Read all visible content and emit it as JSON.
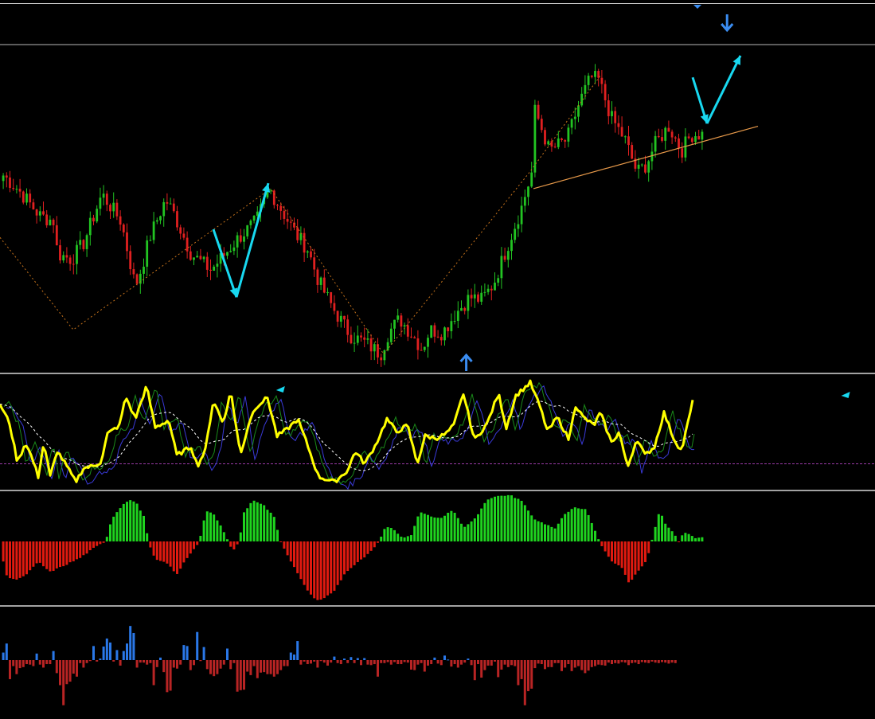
{
  "colors": {
    "background": "#000000",
    "separator": "#d8d8d8",
    "level_line": "#b8b8b8",
    "bull_candle": "#22c422",
    "bear_candle": "#e02020",
    "zigzag": "#c8741c",
    "trendline": "#e89a4a",
    "arrow": "#18d8f0",
    "signal_arrow": "#3a8cf0",
    "oscillator_main": "#ffff00",
    "oscillator_fast": "#1a8a1a",
    "oscillator_slow": "#3a3ad8",
    "oscillator_signal": "#ffffff",
    "oscillator_level": "#9a3aa8",
    "histogram_pos": "#1fd41f",
    "histogram_neg": "#e01a10",
    "volume_pos": "#2a78e8",
    "volume_neg": "#b82424"
  },
  "chart_data": [
    {
      "type": "candlestick",
      "pane": "price",
      "title": "",
      "xlabel": "",
      "ylabel": "",
      "ylim": [
        0,
        100
      ],
      "grid": false,
      "bars": 210,
      "path_points": [
        [
          0,
          70
        ],
        [
          22,
          64
        ],
        [
          50,
          54
        ],
        [
          68,
          52
        ],
        [
          72,
          40
        ],
        [
          90,
          38
        ],
        [
          105,
          44
        ],
        [
          128,
          62
        ],
        [
          140,
          57
        ],
        [
          152,
          52
        ],
        [
          170,
          28
        ],
        [
          178,
          35
        ],
        [
          188,
          46
        ],
        [
          208,
          60
        ],
        [
          218,
          55
        ],
        [
          240,
          40
        ],
        [
          265,
          34
        ],
        [
          300,
          46
        ],
        [
          322,
          52
        ],
        [
          338,
          64
        ],
        [
          352,
          57
        ],
        [
          372,
          47
        ],
        [
          386,
          42
        ],
        [
          400,
          30
        ],
        [
          418,
          20
        ],
        [
          440,
          10
        ],
        [
          460,
          7
        ],
        [
          478,
          3
        ],
        [
          488,
          11
        ],
        [
          502,
          16
        ],
        [
          518,
          10
        ],
        [
          530,
          5
        ],
        [
          540,
          12
        ],
        [
          556,
          11
        ],
        [
          572,
          18
        ],
        [
          590,
          24
        ],
        [
          605,
          23
        ],
        [
          620,
          29
        ],
        [
          640,
          45
        ],
        [
          655,
          57
        ],
        [
          668,
          70
        ],
        [
          672,
          93
        ],
        [
          690,
          78
        ],
        [
          712,
          82
        ],
        [
          728,
          96
        ],
        [
          742,
          105
        ],
        [
          752,
          104
        ],
        [
          768,
          90
        ],
        [
          785,
          82
        ],
        [
          800,
          70
        ],
        [
          812,
          73
        ],
        [
          822,
          80
        ],
        [
          840,
          87
        ],
        [
          856,
          78
        ],
        [
          868,
          84
        ]
      ],
      "zigzag": [
        [
          0,
          46
        ],
        [
          92,
          12
        ],
        [
          340,
          64
        ],
        [
          482,
          3
        ],
        [
          665,
          70
        ],
        [
          755,
          106
        ]
      ],
      "trendline": [
        [
          670,
          64
        ],
        [
          952,
          87
        ]
      ],
      "resistance_level": 100,
      "arrows": [
        {
          "from": [
            268,
            49
          ],
          "to": [
            297,
            24
          ]
        },
        {
          "from": [
            297,
            24
          ],
          "to": [
            337,
            66
          ]
        },
        {
          "from": [
            870,
            105
          ],
          "to": [
            888,
            88
          ]
        },
        {
          "from": [
            888,
            88
          ],
          "to": [
            930,
            113
          ]
        }
      ],
      "signal_arrows": [
        {
          "bar": 138,
          "direction": "up"
        },
        {
          "bar": 216,
          "direction": "down"
        }
      ]
    },
    {
      "type": "line",
      "pane": "oscillator",
      "ylim": [
        0,
        100
      ],
      "level": 22,
      "series_points": [
        [
          0,
          78
        ],
        [
          12,
          60
        ],
        [
          22,
          23
        ],
        [
          32,
          42
        ],
        [
          40,
          28
        ],
        [
          48,
          10
        ],
        [
          55,
          42
        ],
        [
          63,
          10
        ],
        [
          72,
          34
        ],
        [
          82,
          22
        ],
        [
          95,
          5
        ],
        [
          105,
          18
        ],
        [
          118,
          20
        ],
        [
          127,
          24
        ],
        [
          135,
          50
        ],
        [
          150,
          58
        ],
        [
          158,
          85
        ],
        [
          170,
          64
        ],
        [
          184,
          95
        ],
        [
          195,
          56
        ],
        [
          212,
          63
        ],
        [
          222,
          30
        ],
        [
          240,
          38
        ],
        [
          248,
          20
        ],
        [
          258,
          35
        ],
        [
          268,
          82
        ],
        [
          280,
          60
        ],
        [
          290,
          90
        ],
        [
          302,
          30
        ],
        [
          314,
          64
        ],
        [
          322,
          76
        ],
        [
          336,
          84
        ],
        [
          348,
          48
        ],
        [
          360,
          54
        ],
        [
          374,
          64
        ],
        [
          386,
          40
        ],
        [
          400,
          10
        ],
        [
          420,
          5
        ],
        [
          437,
          16
        ],
        [
          446,
          34
        ],
        [
          458,
          22
        ],
        [
          472,
          40
        ],
        [
          486,
          64
        ],
        [
          498,
          52
        ],
        [
          512,
          58
        ],
        [
          524,
          22
        ],
        [
          534,
          48
        ],
        [
          548,
          46
        ],
        [
          560,
          50
        ],
        [
          570,
          58
        ],
        [
          582,
          88
        ],
        [
          596,
          44
        ],
        [
          612,
          60
        ],
        [
          626,
          88
        ],
        [
          636,
          56
        ],
        [
          648,
          86
        ],
        [
          666,
          98
        ],
        [
          678,
          76
        ],
        [
          688,
          52
        ],
        [
          700,
          66
        ],
        [
          715,
          44
        ],
        [
          722,
          78
        ],
        [
          732,
          66
        ],
        [
          746,
          58
        ],
        [
          754,
          70
        ],
        [
          768,
          42
        ],
        [
          778,
          52
        ],
        [
          788,
          18
        ],
        [
          800,
          46
        ],
        [
          810,
          30
        ],
        [
          822,
          38
        ],
        [
          834,
          70
        ],
        [
          846,
          46
        ],
        [
          856,
          34
        ],
        [
          870,
          80
        ]
      ],
      "arrows": [
        {
          "bar": 84,
          "direction": "left"
        },
        {
          "bar": 253,
          "direction": "left"
        }
      ]
    },
    {
      "type": "bar",
      "pane": "histogram",
      "ylim": [
        -100,
        100
      ],
      "shape_points": [
        [
          0,
          -12
        ],
        [
          8,
          -55
        ],
        [
          20,
          -60
        ],
        [
          30,
          -55
        ],
        [
          48,
          -32
        ],
        [
          62,
          -48
        ],
        [
          80,
          -38
        ],
        [
          100,
          -26
        ],
        [
          118,
          -10
        ],
        [
          132,
          0
        ],
        [
          140,
          36
        ],
        [
          155,
          60
        ],
        [
          162,
          65
        ],
        [
          170,
          62
        ],
        [
          180,
          40
        ],
        [
          186,
          0
        ],
        [
          194,
          -28
        ],
        [
          210,
          -35
        ],
        [
          222,
          -52
        ],
        [
          232,
          -30
        ],
        [
          244,
          -10
        ],
        [
          250,
          0
        ],
        [
          258,
          48
        ],
        [
          268,
          42
        ],
        [
          278,
          22
        ],
        [
          286,
          0
        ],
        [
          292,
          -14
        ],
        [
          300,
          0
        ],
        [
          306,
          46
        ],
        [
          318,
          65
        ],
        [
          330,
          58
        ],
        [
          344,
          38
        ],
        [
          352,
          0
        ],
        [
          366,
          -34
        ],
        [
          382,
          -70
        ],
        [
          394,
          -90
        ],
        [
          402,
          -92
        ],
        [
          418,
          -80
        ],
        [
          434,
          -48
        ],
        [
          450,
          -32
        ],
        [
          464,
          -18
        ],
        [
          476,
          0
        ],
        [
          484,
          24
        ],
        [
          494,
          20
        ],
        [
          504,
          6
        ],
        [
          516,
          10
        ],
        [
          526,
          46
        ],
        [
          540,
          40
        ],
        [
          552,
          36
        ],
        [
          568,
          50
        ],
        [
          582,
          22
        ],
        [
          596,
          36
        ],
        [
          612,
          66
        ],
        [
          626,
          72
        ],
        [
          642,
          72
        ],
        [
          656,
          62
        ],
        [
          670,
          36
        ],
        [
          680,
          30
        ],
        [
          696,
          20
        ],
        [
          708,
          42
        ],
        [
          720,
          54
        ],
        [
          736,
          50
        ],
        [
          746,
          20
        ],
        [
          752,
          0
        ],
        [
          768,
          -32
        ],
        [
          780,
          -40
        ],
        [
          790,
          -66
        ],
        [
          800,
          -48
        ],
        [
          812,
          -30
        ],
        [
          818,
          0
        ],
        [
          828,
          48
        ],
        [
          836,
          26
        ],
        [
          846,
          12
        ],
        [
          852,
          0
        ],
        [
          858,
          14
        ],
        [
          866,
          12
        ],
        [
          870,
          6
        ]
      ]
    },
    {
      "type": "bar",
      "pane": "volume",
      "ylim": [
        -100,
        100
      ],
      "values": [
        15,
        33,
        -38,
        -12,
        -28,
        -16,
        -14,
        -8,
        -9,
        -12,
        13,
        -9,
        -15,
        -8,
        -8,
        18,
        -26,
        -50,
        -90,
        -48,
        -43,
        -27,
        -33,
        -6,
        -15,
        -6,
        -2,
        28,
        -3,
        3,
        27,
        43,
        35,
        -3,
        20,
        -11,
        18,
        33,
        68,
        54,
        -15,
        -5,
        -5,
        -9,
        -6,
        -50,
        -14,
        5,
        -24,
        -64,
        -61,
        -15,
        -17,
        -9,
        30,
        28,
        -20,
        -10,
        56,
        -2,
        26,
        -18,
        -28,
        -32,
        -28,
        -17,
        -9,
        23,
        -18,
        -6,
        -63,
        -60,
        -59,
        -23,
        -30,
        -12,
        -36,
        -25,
        -24,
        -28,
        -28,
        -33,
        -28,
        -20,
        -12,
        -12,
        15,
        11,
        38,
        -9,
        -3,
        -8,
        -7,
        -3,
        -15,
        -2,
        -5,
        -11,
        -5,
        7,
        -6,
        -8,
        3,
        -6,
        6,
        -6,
        4,
        -10,
        4,
        -9,
        -10,
        -8,
        -33,
        -6,
        -6,
        -4,
        -9,
        -4,
        -8,
        -8,
        -4,
        -5,
        -19,
        -20,
        -9,
        -6,
        -23,
        -11,
        -8,
        5,
        -7,
        -10,
        9,
        1,
        -13,
        -8,
        -15,
        -9,
        -5,
        3,
        -10,
        -40,
        -8,
        -35,
        -20,
        -11,
        -11,
        -3,
        -34,
        -19,
        -9,
        -14,
        -10,
        -12,
        -50,
        -38,
        -90,
        -62,
        -57,
        -16,
        -7,
        -8,
        -18,
        -14,
        -14,
        -6,
        -6,
        -22,
        -15,
        -8,
        -22,
        -15,
        -12,
        -20,
        -26,
        -21,
        -14,
        -12,
        -9,
        -10,
        -11,
        -5,
        -8,
        -6,
        -7,
        -4,
        -5,
        -10,
        -6,
        -5,
        -8,
        -4,
        -5,
        -6,
        -3,
        -5,
        -6,
        -4,
        -5,
        -7,
        -5,
        -6
      ]
    }
  ]
}
